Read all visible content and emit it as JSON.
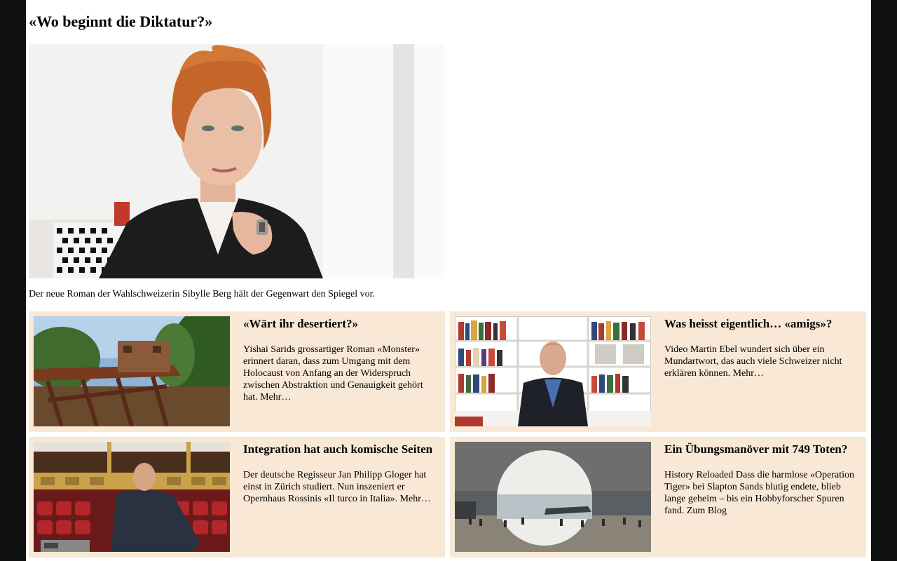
{
  "main_story": {
    "headline": "«Wo beginnt die Diktatur?»",
    "image_icon": "portrait-photo",
    "caption": "Der neue Roman der Wahlschweizerin Sibylle Berg hält der Gegenwart den Spiegel vor."
  },
  "teasers": [
    {
      "title": "«Wärt ihr desertiert?»",
      "text": "Yishai Sarids grossartiger Roman «Monster» erinnert daran, dass zum Umgang mit dem Holocaust von Anfang an der Widerspruch zwischen Abstraktion und Genauigkeit gehört hat. Mehr…",
      "image_icon": "railway-wagon-photo"
    },
    {
      "title": "Was heisst eigentlich… «amigs»?",
      "text": "Video Martin Ebel wundert sich über ein Mundartwort, das auch viele Schweizer nicht erklären können. Mehr…",
      "image_icon": "bookshelf-video-photo"
    },
    {
      "title": "Integration hat auch komische Seiten",
      "text": "Der deutsche Regisseur Jan Philipp Gloger hat einst in Zürich studiert. Nun inszeniert er Opernhaus Rossinis «Il turco in Italia». Mehr…",
      "image_icon": "opera-house-photo"
    },
    {
      "title": "Ein Übungsmanöver mit 749 Toten?",
      "text": "History Reloaded Dass die harmlose «Operation Tiger» bei Slapton Sands blutig endete, blieb lange geheim – bis ein Hobbyforscher Spuren fand. Zum Blog",
      "image_icon": "beach-landing-photo"
    }
  ],
  "colors": {
    "page_background": "#ffffff",
    "outer_background": "#111111",
    "teaser_background": "#f9e8d5"
  }
}
